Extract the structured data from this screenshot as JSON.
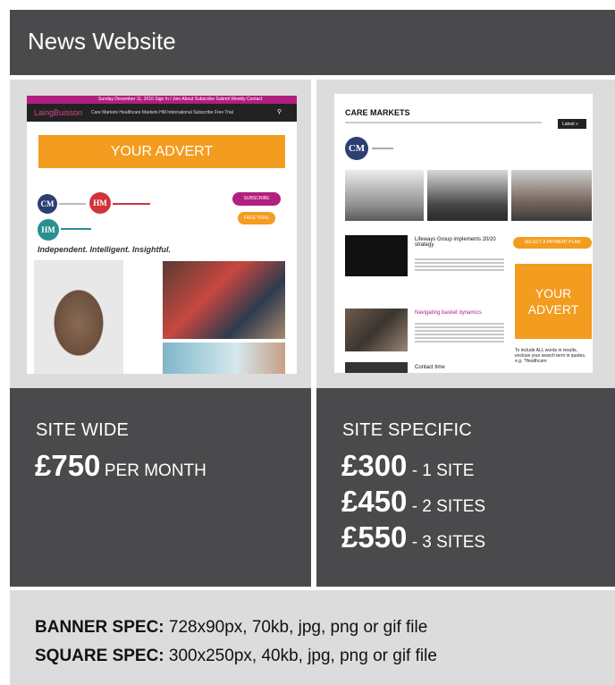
{
  "header": {
    "title": "News Website"
  },
  "mock_left": {
    "topbar_text": "Sunday December 11, 2016   Sign In / Join   About   Subscribe   Submit   Weekly   Contact",
    "brand": "LaingBuisson",
    "nav": "Care Markets   Healthcare Markets   HM International   Subscribe   Free Trial",
    "advert": "YOUR ADVERT",
    "logo_cm": "CM",
    "logo_hm": "HM",
    "logo_hm2": "HM",
    "tagline": "Independent. Intelligent. Insightful.",
    "subscribe_btn": "SUBSCRIBE",
    "trial_btn": "FREE TRIAL"
  },
  "mock_right": {
    "site_title": "CARE MARKETS",
    "latest_btn": "Latest »",
    "logo_cm": "CM",
    "headline_1": "Lifeways Group implements 20/20 strategy",
    "headline_2": "Navigating basket dynamics",
    "headline_3": "Contact time",
    "select_btn": "SELECT A PAYMENT PLAN",
    "advert": "YOUR ADVERT",
    "note": "To include ALL words in results, enclose your search term in quotes, e.g. \"Healthcare"
  },
  "site_wide": {
    "title": "SITE WIDE",
    "price": "£750",
    "unit": "PER MONTH"
  },
  "site_specific": {
    "title": "SITE SPECIFIC",
    "rows": [
      {
        "price": "£300",
        "label": " - 1 SITE"
      },
      {
        "price": "£450",
        "label": " - 2 SITES"
      },
      {
        "price": "£550",
        "label": " - 3 SITES"
      }
    ]
  },
  "spec": {
    "banner_label": "BANNER SPEC:",
    "banner_value": " 728x90px, 70kb, jpg, png or gif file",
    "square_label": "SQUARE SPEC:",
    "square_value": " 300x250px, 40kb, jpg, png or gif file"
  },
  "colors": {
    "dark": "#4a4a4c",
    "light": "#dcdcdc",
    "orange": "#f39c1f",
    "magenta": "#b21f7e"
  }
}
